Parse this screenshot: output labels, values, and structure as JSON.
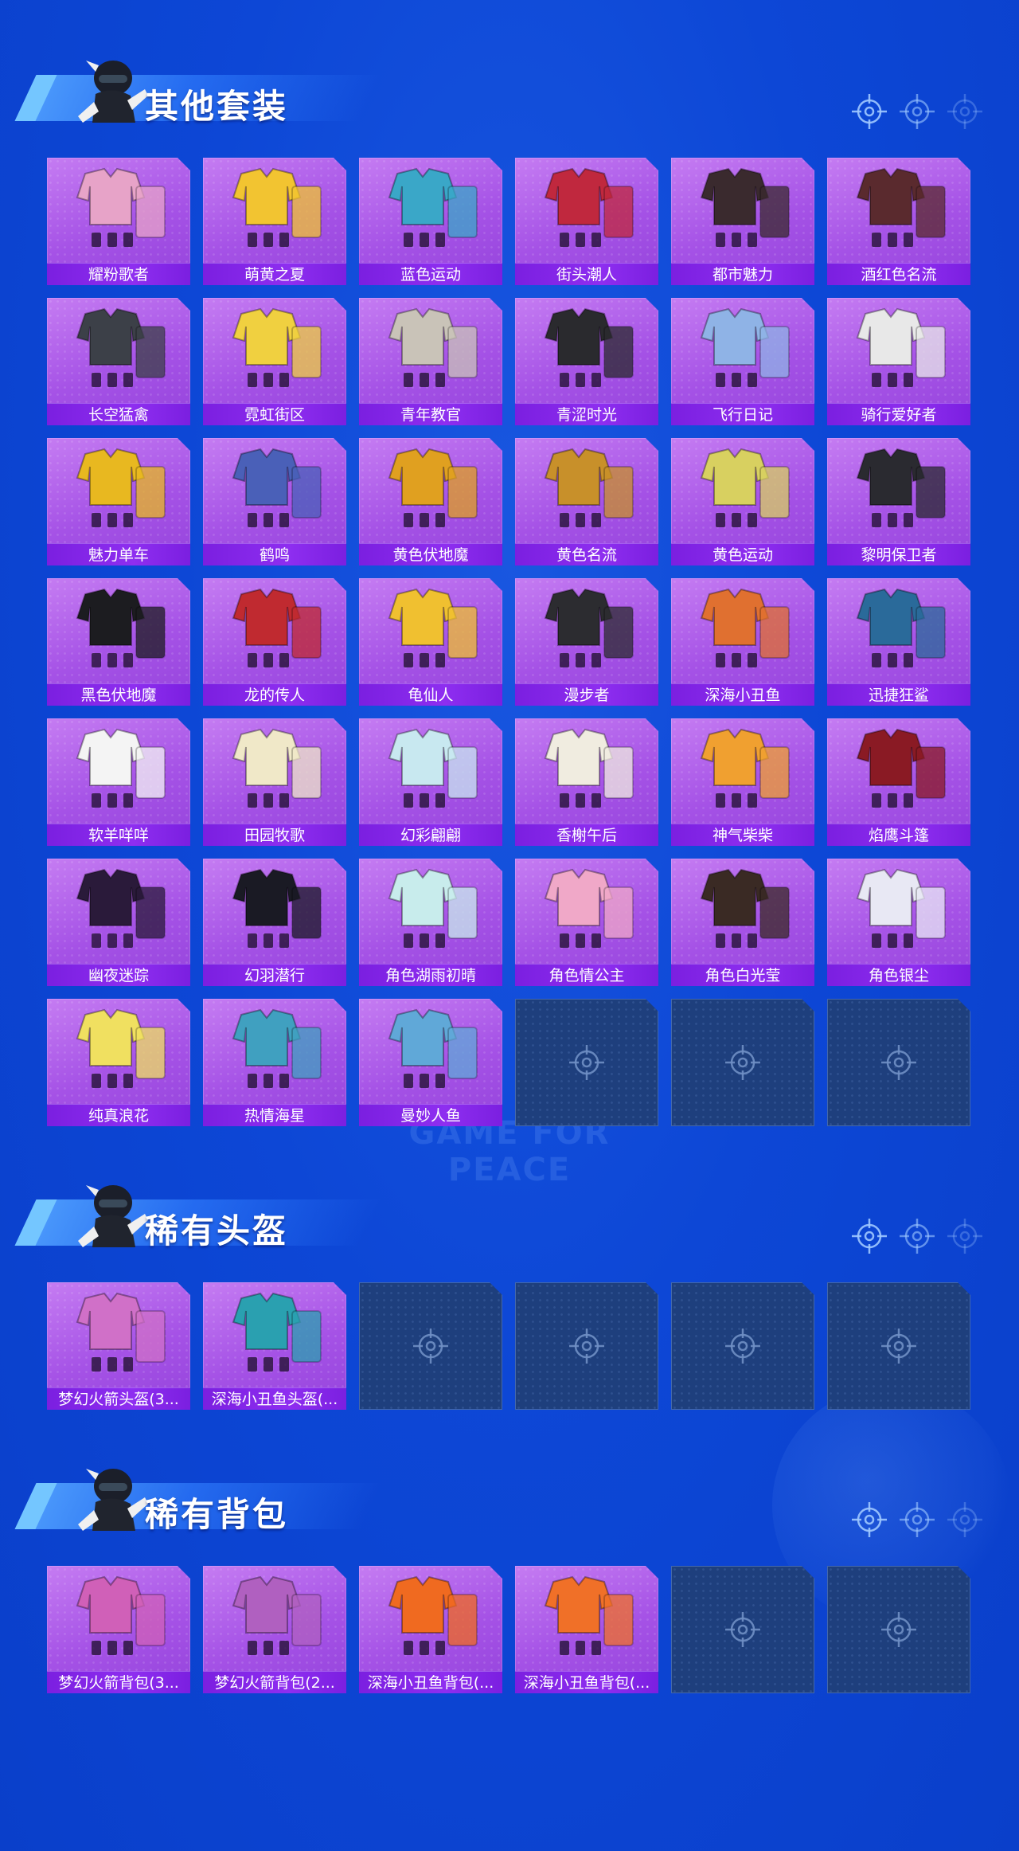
{
  "sections": [
    {
      "title": "其他套装",
      "items": [
        {
          "label": "耀粉歌者",
          "color": "#e7a3c8"
        },
        {
          "label": "萌黄之夏",
          "color": "#f2c431"
        },
        {
          "label": "蓝色运动",
          "color": "#3aa7c8"
        },
        {
          "label": "街头潮人",
          "color": "#c0283e"
        },
        {
          "label": "都市魅力",
          "color": "#3a2a2e"
        },
        {
          "label": "酒红色名流",
          "color": "#5a2a2e"
        },
        {
          "label": "长空猛禽",
          "color": "#3c4048"
        },
        {
          "label": "霓虹街区",
          "color": "#f0d040"
        },
        {
          "label": "青年教官",
          "color": "#c9c3b8"
        },
        {
          "label": "青涩时光",
          "color": "#2a2a2e"
        },
        {
          "label": "飞行日记",
          "color": "#8fb3e6"
        },
        {
          "label": "骑行爱好者",
          "color": "#e8e8e8"
        },
        {
          "label": "魅力单车",
          "color": "#e8b820"
        },
        {
          "label": "鹤鸣",
          "color": "#4a60b8"
        },
        {
          "label": "黄色伏地魔",
          "color": "#e0a020"
        },
        {
          "label": "黄色名流",
          "color": "#c8902a"
        },
        {
          "label": "黄色运动",
          "color": "#d8d060"
        },
        {
          "label": "黎明保卫者",
          "color": "#2a2a30"
        },
        {
          "label": "黑色伏地魔",
          "color": "#1c1c20"
        },
        {
          "label": "龙的传人",
          "color": "#c02a30"
        },
        {
          "label": "龟仙人",
          "color": "#f0c030"
        },
        {
          "label": "漫步者",
          "color": "#2c2c30"
        },
        {
          "label": "深海小丑鱼",
          "color": "#e07030"
        },
        {
          "label": "迅捷狂鲨",
          "color": "#2a6a9a"
        },
        {
          "label": "软羊咩咩",
          "color": "#f4f4f4"
        },
        {
          "label": "田园牧歌",
          "color": "#f0e8c8"
        },
        {
          "label": "幻彩翩翩",
          "color": "#c8e8f0"
        },
        {
          "label": "香榭午后",
          "color": "#f0ece0"
        },
        {
          "label": "神气柴柴",
          "color": "#f0a030"
        },
        {
          "label": "焰鹰斗篷",
          "color": "#8a1a24"
        },
        {
          "label": "幽夜迷踪",
          "color": "#2a1a3a"
        },
        {
          "label": "幻羽潜行",
          "color": "#1a1a24"
        },
        {
          "label": "角色湖雨初晴",
          "color": "#c8ecec"
        },
        {
          "label": "角色情公主",
          "color": "#f0a8c8"
        },
        {
          "label": "角色白光莹",
          "color": "#3a2a24"
        },
        {
          "label": "角色银尘",
          "color": "#e8e8f4"
        },
        {
          "label": "纯真浪花",
          "color": "#f0e060"
        },
        {
          "label": "热情海星",
          "color": "#40a0c0"
        },
        {
          "label": "曼妙人鱼",
          "color": "#60a8d8"
        }
      ],
      "empty_count": 3
    },
    {
      "title": "稀有头盔",
      "items": [
        {
          "label": "梦幻火箭头盔(3...",
          "color": "#d070c8"
        },
        {
          "label": "深海小丑鱼头盔(...",
          "color": "#2aa0b0"
        }
      ],
      "empty_count": 4
    },
    {
      "title": "稀有背包",
      "items": [
        {
          "label": "梦幻火箭背包(3...",
          "color": "#d060b8"
        },
        {
          "label": "梦幻火箭背包(2...",
          "color": "#b060c0"
        },
        {
          "label": "深海小丑鱼背包(...",
          "color": "#f06a20"
        },
        {
          "label": "深海小丑鱼背包(...",
          "color": "#f07028"
        }
      ],
      "empty_count": 2
    }
  ],
  "watermark": "GAME FOR PEACE",
  "icons": {
    "header_scope": "crosshair-icon",
    "empty_slot": "crosshair-icon",
    "mascot": "soldier-mascot-icon"
  }
}
